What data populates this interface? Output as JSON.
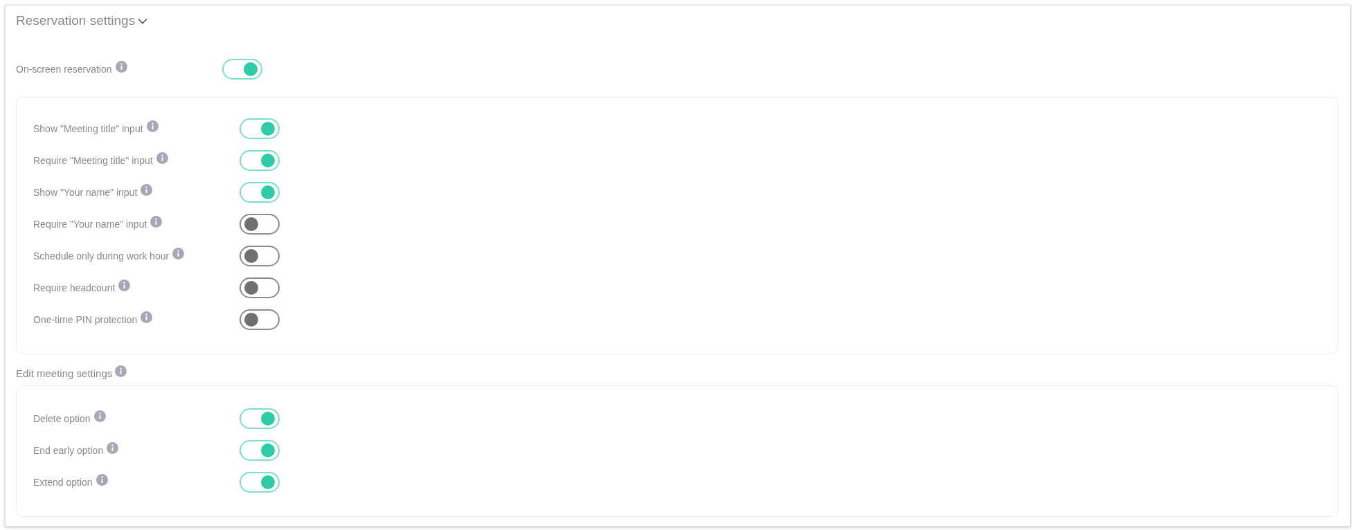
{
  "section": {
    "title": "Reservation settings",
    "expanded": true
  },
  "main_setting": {
    "label": "On-screen reservation",
    "on": true
  },
  "reservation_options": [
    {
      "label": "Show \"Meeting title\" input",
      "on": true
    },
    {
      "label": "Require \"Meeting title\" input",
      "on": true
    },
    {
      "label": "Show \"Your name\" input",
      "on": true
    },
    {
      "label": "Require \"Your name\" input",
      "on": false
    },
    {
      "label": "Schedule only during work hour",
      "on": false
    },
    {
      "label": "Require headcount",
      "on": false
    },
    {
      "label": "One-time PIN protection",
      "on": false
    }
  ],
  "edit_meeting": {
    "title": "Edit meeting settings",
    "options": [
      {
        "label": "Delete option",
        "on": true
      },
      {
        "label": "End early option",
        "on": true
      },
      {
        "label": "Extend option",
        "on": true
      }
    ]
  }
}
